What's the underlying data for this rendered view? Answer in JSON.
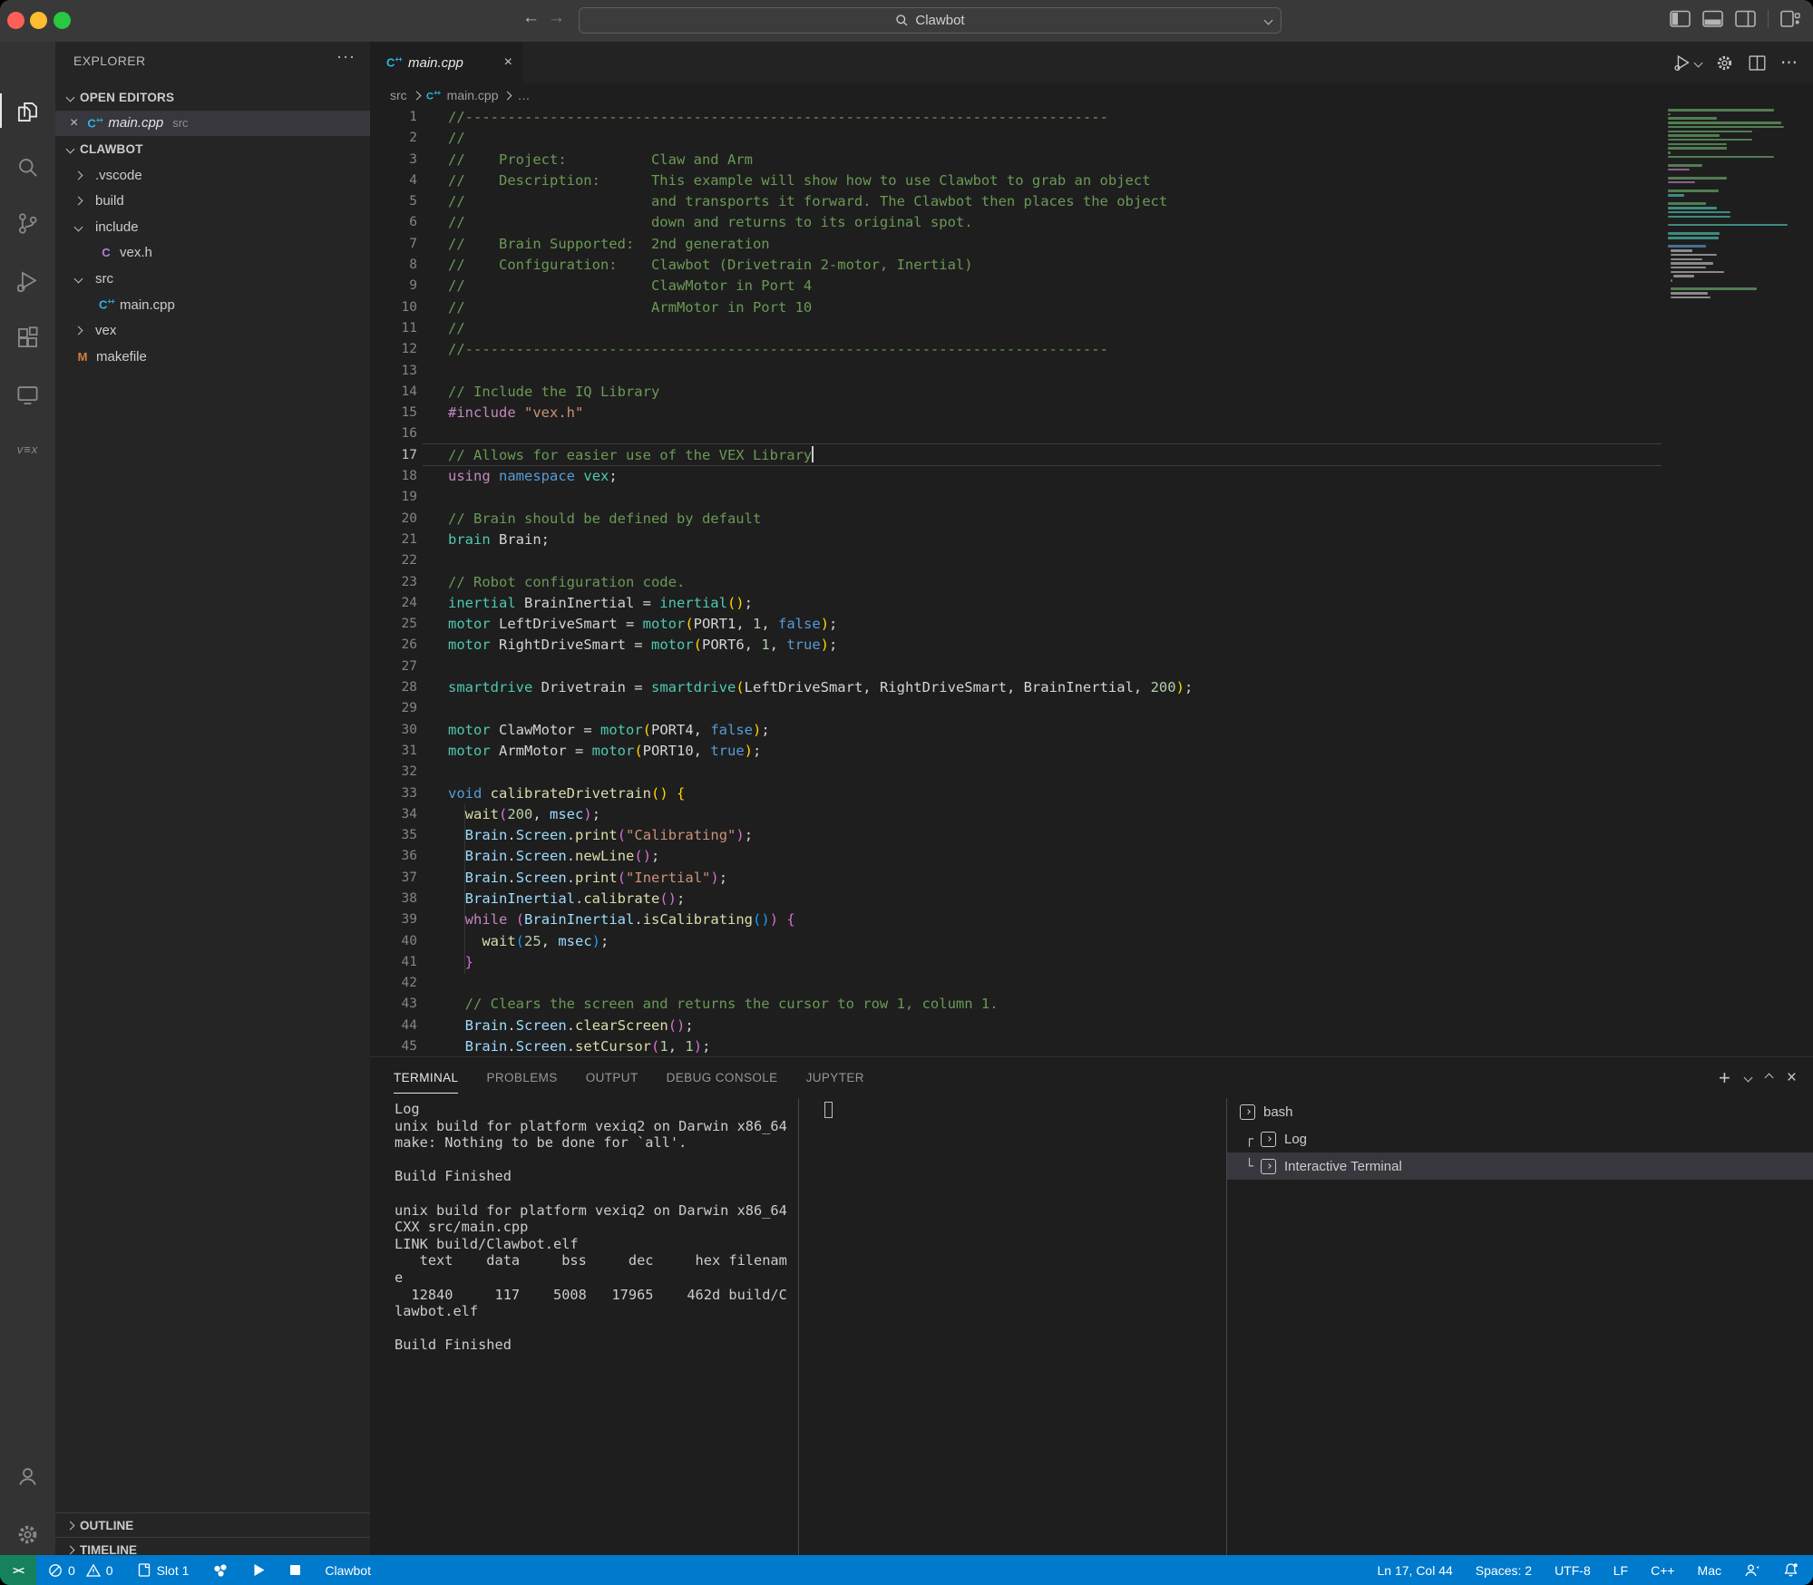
{
  "titlebar": {
    "search_label": "Clawbot",
    "traffic_lights": [
      "close",
      "minimize",
      "zoom"
    ]
  },
  "activity_bar": {
    "top": [
      {
        "name": "explorer",
        "active": true
      },
      {
        "name": "search"
      },
      {
        "name": "source-control"
      },
      {
        "name": "run-debug"
      },
      {
        "name": "extensions"
      },
      {
        "name": "remote-explorer"
      },
      {
        "name": "vex",
        "label": "vex"
      }
    ],
    "bottom": [
      {
        "name": "accounts"
      },
      {
        "name": "settings"
      }
    ]
  },
  "sidebar": {
    "title": "EXPLORER",
    "more_label": "···",
    "open_editors_header": "OPEN EDITORS",
    "open_editor": {
      "file": "main.cpp",
      "detail": "src",
      "close_label": "×"
    },
    "folder_header": "CLAWBOT",
    "tree": [
      {
        "label": ".vscode",
        "arrow": "right",
        "indent": 1
      },
      {
        "label": "build",
        "arrow": "right",
        "indent": 1
      },
      {
        "label": "include",
        "arrow": "down",
        "indent": 1
      },
      {
        "label": "vex.h",
        "icon": "c-header",
        "indent": 2
      },
      {
        "label": "src",
        "arrow": "down",
        "indent": 1
      },
      {
        "label": "main.cpp",
        "icon": "cpp",
        "indent": 2
      },
      {
        "label": "vex",
        "arrow": "right",
        "indent": 1
      },
      {
        "label": "makefile",
        "icon": "makefile",
        "indent": 1
      }
    ],
    "outline_header": "OUTLINE",
    "timeline_header": "TIMELINE"
  },
  "editor": {
    "tab": {
      "label": "main.cpp",
      "close_label": "×"
    },
    "breadcrumb": [
      "src",
      "main.cpp",
      "…"
    ],
    "cursor_line": 17,
    "lines": [
      [
        [
          "c",
          "//----------------------------------------------------------------------------"
        ]
      ],
      [
        [
          "c",
          "//"
        ]
      ],
      [
        [
          "c",
          "//    Project:          Claw and Arm"
        ]
      ],
      [
        [
          "c",
          "//    Description:      This example will show how to use Clawbot to grab an object"
        ]
      ],
      [
        [
          "c",
          "//                      and transports it forward. The Clawbot then places the object"
        ]
      ],
      [
        [
          "c",
          "//                      down and returns to its original spot."
        ]
      ],
      [
        [
          "c",
          "//    Brain Supported:  2nd generation"
        ]
      ],
      [
        [
          "c",
          "//    Configuration:    Clawbot (Drivetrain 2-motor, Inertial)"
        ]
      ],
      [
        [
          "c",
          "//                      ClawMotor in Port 4"
        ]
      ],
      [
        [
          "c",
          "//                      ArmMotor in Port 10"
        ]
      ],
      [
        [
          "c",
          "//"
        ]
      ],
      [
        [
          "c",
          "//----------------------------------------------------------------------------"
        ]
      ],
      [],
      [
        [
          "c",
          "// Include the IQ Library"
        ]
      ],
      [
        [
          "m",
          "#include "
        ],
        [
          "s",
          "\"vex.h\""
        ]
      ],
      [],
      [
        [
          "c",
          "// Allows for easier use of the VEX Library"
        ]
      ],
      [
        [
          "m",
          "using"
        ],
        [
          "w",
          " "
        ],
        [
          "k",
          "namespace"
        ],
        [
          "w",
          " "
        ],
        [
          "t",
          "vex"
        ],
        [
          "w",
          ";"
        ]
      ],
      [],
      [
        [
          "c",
          "// Brain should be defined by default"
        ]
      ],
      [
        [
          "t",
          "brain"
        ],
        [
          "w",
          " Brain;"
        ]
      ],
      [],
      [
        [
          "c",
          "// Robot configuration code."
        ]
      ],
      [
        [
          "t",
          "inertial"
        ],
        [
          "w",
          " BrainInertial = "
        ],
        [
          "t",
          "inertial"
        ],
        [
          "g",
          "()"
        ],
        [
          "w",
          ";"
        ]
      ],
      [
        [
          "t",
          "motor"
        ],
        [
          "w",
          " LeftDriveSmart = "
        ],
        [
          "t",
          "motor"
        ],
        [
          "g",
          "("
        ],
        [
          "w",
          "PORT1, "
        ],
        [
          "n",
          "1"
        ],
        [
          "w",
          ", "
        ],
        [
          "k",
          "false"
        ],
        [
          "g",
          ")"
        ],
        [
          "w",
          ";"
        ]
      ],
      [
        [
          "t",
          "motor"
        ],
        [
          "w",
          " RightDriveSmart = "
        ],
        [
          "t",
          "motor"
        ],
        [
          "g",
          "("
        ],
        [
          "w",
          "PORT6, "
        ],
        [
          "n",
          "1"
        ],
        [
          "w",
          ", "
        ],
        [
          "k",
          "true"
        ],
        [
          "g",
          ")"
        ],
        [
          "w",
          ";"
        ]
      ],
      [],
      [
        [
          "t",
          "smartdrive"
        ],
        [
          "w",
          " Drivetrain = "
        ],
        [
          "t",
          "smartdrive"
        ],
        [
          "g",
          "("
        ],
        [
          "w",
          "LeftDriveSmart, RightDriveSmart, BrainInertial, "
        ],
        [
          "n",
          "200"
        ],
        [
          "g",
          ")"
        ],
        [
          "w",
          ";"
        ]
      ],
      [],
      [
        [
          "t",
          "motor"
        ],
        [
          "w",
          " ClawMotor = "
        ],
        [
          "t",
          "motor"
        ],
        [
          "g",
          "("
        ],
        [
          "w",
          "PORT4, "
        ],
        [
          "k",
          "false"
        ],
        [
          "g",
          ")"
        ],
        [
          "w",
          ";"
        ]
      ],
      [
        [
          "t",
          "motor"
        ],
        [
          "w",
          " ArmMotor = "
        ],
        [
          "t",
          "motor"
        ],
        [
          "g",
          "("
        ],
        [
          "w",
          "PORT10, "
        ],
        [
          "k",
          "true"
        ],
        [
          "g",
          ")"
        ],
        [
          "w",
          ";"
        ]
      ],
      [],
      [
        [
          "k",
          "void"
        ],
        [
          "w",
          " "
        ],
        [
          "f",
          "calibrateDrivetrain"
        ],
        [
          "g",
          "()"
        ],
        [
          "w",
          " "
        ],
        [
          "g",
          "{"
        ]
      ],
      [
        [
          "w",
          "  "
        ],
        [
          "f",
          "wait"
        ],
        [
          "p",
          "("
        ],
        [
          "n",
          "200"
        ],
        [
          "w",
          ", "
        ],
        [
          "v",
          "msec"
        ],
        [
          "p",
          ")"
        ],
        [
          "w",
          ";"
        ]
      ],
      [
        [
          "w",
          "  "
        ],
        [
          "v",
          "Brain"
        ],
        [
          "w",
          "."
        ],
        [
          "v",
          "Screen"
        ],
        [
          "w",
          "."
        ],
        [
          "f",
          "print"
        ],
        [
          "p",
          "("
        ],
        [
          "s",
          "\"Calibrating\""
        ],
        [
          "p",
          ")"
        ],
        [
          "w",
          ";"
        ]
      ],
      [
        [
          "w",
          "  "
        ],
        [
          "v",
          "Brain"
        ],
        [
          "w",
          "."
        ],
        [
          "v",
          "Screen"
        ],
        [
          "w",
          "."
        ],
        [
          "f",
          "newLine"
        ],
        [
          "p",
          "()"
        ],
        [
          "w",
          ";"
        ]
      ],
      [
        [
          "w",
          "  "
        ],
        [
          "v",
          "Brain"
        ],
        [
          "w",
          "."
        ],
        [
          "v",
          "Screen"
        ],
        [
          "w",
          "."
        ],
        [
          "f",
          "print"
        ],
        [
          "p",
          "("
        ],
        [
          "s",
          "\"Inertial\""
        ],
        [
          "p",
          ")"
        ],
        [
          "w",
          ";"
        ]
      ],
      [
        [
          "w",
          "  "
        ],
        [
          "v",
          "BrainInertial"
        ],
        [
          "w",
          "."
        ],
        [
          "f",
          "calibrate"
        ],
        [
          "p",
          "()"
        ],
        [
          "w",
          ";"
        ]
      ],
      [
        [
          "w",
          "  "
        ],
        [
          "m",
          "while"
        ],
        [
          "w",
          " "
        ],
        [
          "p",
          "("
        ],
        [
          "v",
          "BrainInertial"
        ],
        [
          "w",
          "."
        ],
        [
          "f",
          "isCalibrating"
        ],
        [
          "u",
          "()"
        ],
        [
          "p",
          ")"
        ],
        [
          "w",
          " "
        ],
        [
          "p",
          "{"
        ]
      ],
      [
        [
          "w",
          "    "
        ],
        [
          "f",
          "wait"
        ],
        [
          "u",
          "("
        ],
        [
          "n",
          "25"
        ],
        [
          "w",
          ", "
        ],
        [
          "v",
          "msec"
        ],
        [
          "u",
          ")"
        ],
        [
          "w",
          ";"
        ]
      ],
      [
        [
          "p",
          "  }"
        ]
      ],
      [],
      [
        [
          "c",
          "  // Clears the screen and returns the cursor to row 1, column 1."
        ]
      ],
      [
        [
          "w",
          "  "
        ],
        [
          "v",
          "Brain"
        ],
        [
          "w",
          "."
        ],
        [
          "v",
          "Screen"
        ],
        [
          "w",
          "."
        ],
        [
          "f",
          "clearScreen"
        ],
        [
          "p",
          "()"
        ],
        [
          "w",
          ";"
        ]
      ],
      [
        [
          "w",
          "  "
        ],
        [
          "v",
          "Brain"
        ],
        [
          "w",
          "."
        ],
        [
          "v",
          "Screen"
        ],
        [
          "w",
          "."
        ],
        [
          "f",
          "setCursor"
        ],
        [
          "p",
          "("
        ],
        [
          "n",
          "1"
        ],
        [
          "w",
          ", "
        ],
        [
          "n",
          "1"
        ],
        [
          "p",
          ")"
        ],
        [
          "w",
          ";"
        ]
      ]
    ]
  },
  "panel": {
    "tabs": [
      "TERMINAL",
      "PROBLEMS",
      "OUTPUT",
      "DEBUG CONSOLE",
      "JUPYTER"
    ],
    "active_tab": "TERMINAL",
    "terminal_lines": [
      "Log",
      "unix build for platform vexiq2 on Darwin x86_64",
      "make: Nothing to be done for `all'.",
      "",
      "Build Finished",
      "",
      "unix build for platform vexiq2 on Darwin x86_64",
      "CXX src/main.cpp",
      "LINK build/Clawbot.elf",
      "   text    data     bss     dec     hex filenam",
      "e",
      "  12840     117    5008   17965    462d build/C",
      "lawbot.elf",
      "",
      "Build Finished"
    ],
    "terminal_list": [
      {
        "label": "bash",
        "indent": 0
      },
      {
        "label": "Log",
        "indent": 1,
        "tree": "┌"
      },
      {
        "label": "Interactive Terminal",
        "indent": 1,
        "tree": "└",
        "selected": true
      }
    ]
  },
  "status_bar": {
    "remote_label": "><",
    "errors": "0",
    "warnings": "0",
    "slot_label": "Slot 1",
    "project_label": "Clawbot",
    "right_items": [
      "Ln 17, Col 44",
      "Spaces: 2",
      "UTF-8",
      "LF",
      "C++",
      "Mac"
    ]
  },
  "colors": {
    "status_bar": "#007acc",
    "remote_badge": "#16825d",
    "accent_tab_underline": "#e7e7e7",
    "selection_row": "#37373d"
  }
}
